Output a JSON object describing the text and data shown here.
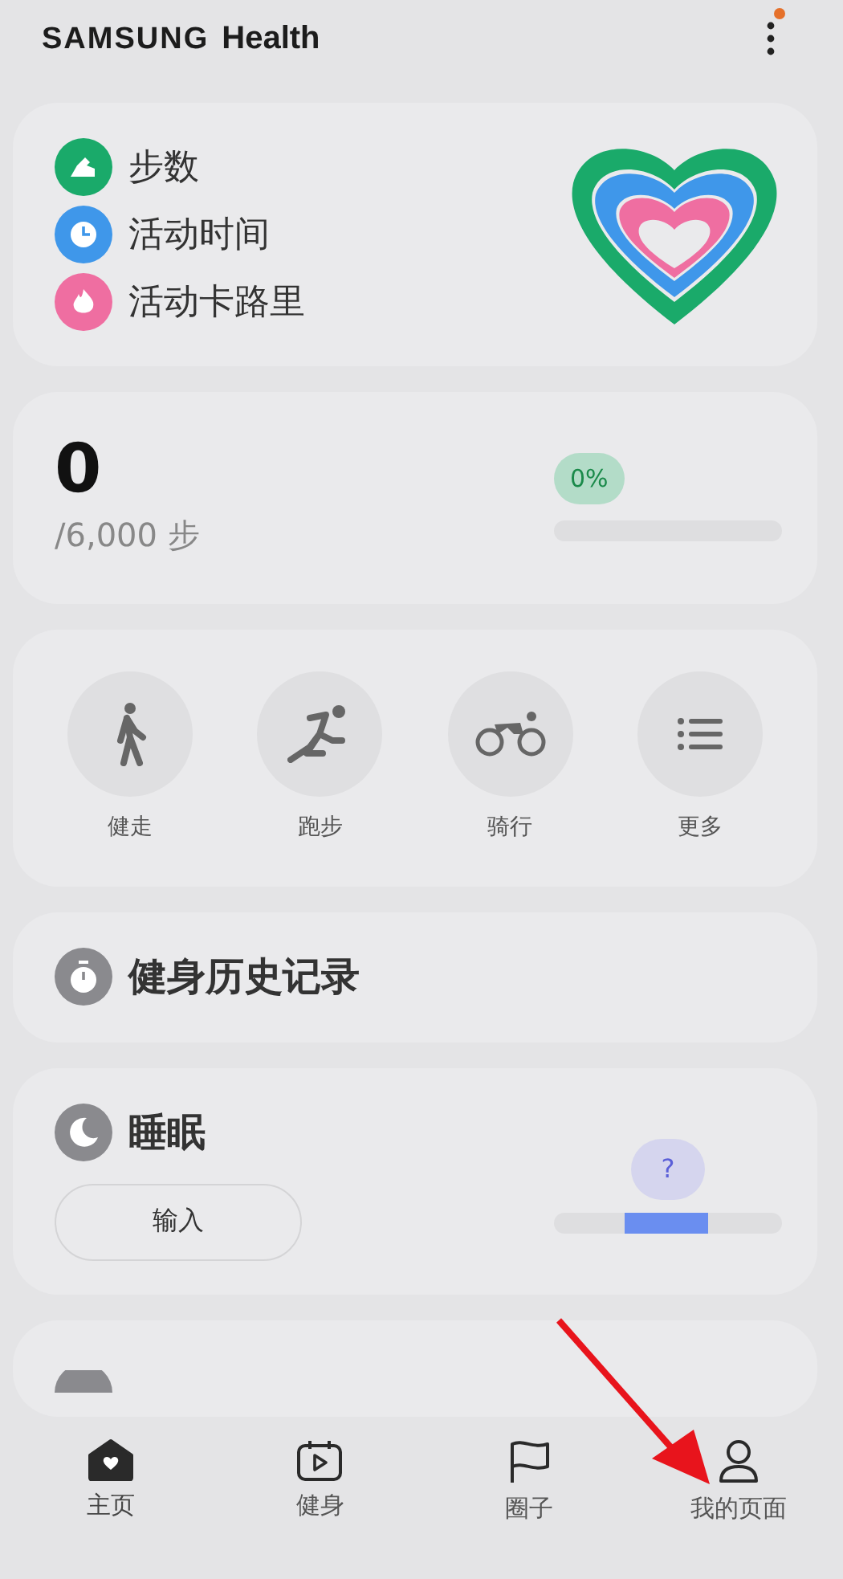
{
  "app": {
    "brand": "SAMSUNG",
    "name": "Health",
    "notification": true
  },
  "rings_card": {
    "items": [
      {
        "label": "步数",
        "kind": "steps",
        "color": "#1aaa6a"
      },
      {
        "label": "活动时间",
        "kind": "time",
        "color": "#3f97ea"
      },
      {
        "label": "活动卡路里",
        "kind": "calories",
        "color": "#ef6ea1"
      }
    ]
  },
  "steps_card": {
    "count": "0",
    "goal": "/6,000 步",
    "percent": "0%",
    "level": 0
  },
  "workouts": [
    {
      "label": "健走",
      "kind": "walk"
    },
    {
      "label": "跑步",
      "kind": "run"
    },
    {
      "label": "骑行",
      "kind": "bike"
    },
    {
      "label": "更多",
      "kind": "more"
    }
  ],
  "history": {
    "title": "健身历史记录"
  },
  "sleep": {
    "title": "睡眠",
    "button": "输入",
    "bubble": "?"
  },
  "food": {
    "kind": "partial"
  },
  "nav": [
    {
      "label": "主页",
      "kind": "home",
      "selected": true
    },
    {
      "label": "健身",
      "kind": "fitness",
      "selected": false
    },
    {
      "label": "圈子",
      "kind": "together",
      "selected": false
    },
    {
      "label": "我的页面",
      "kind": "profile",
      "selected": false
    }
  ]
}
